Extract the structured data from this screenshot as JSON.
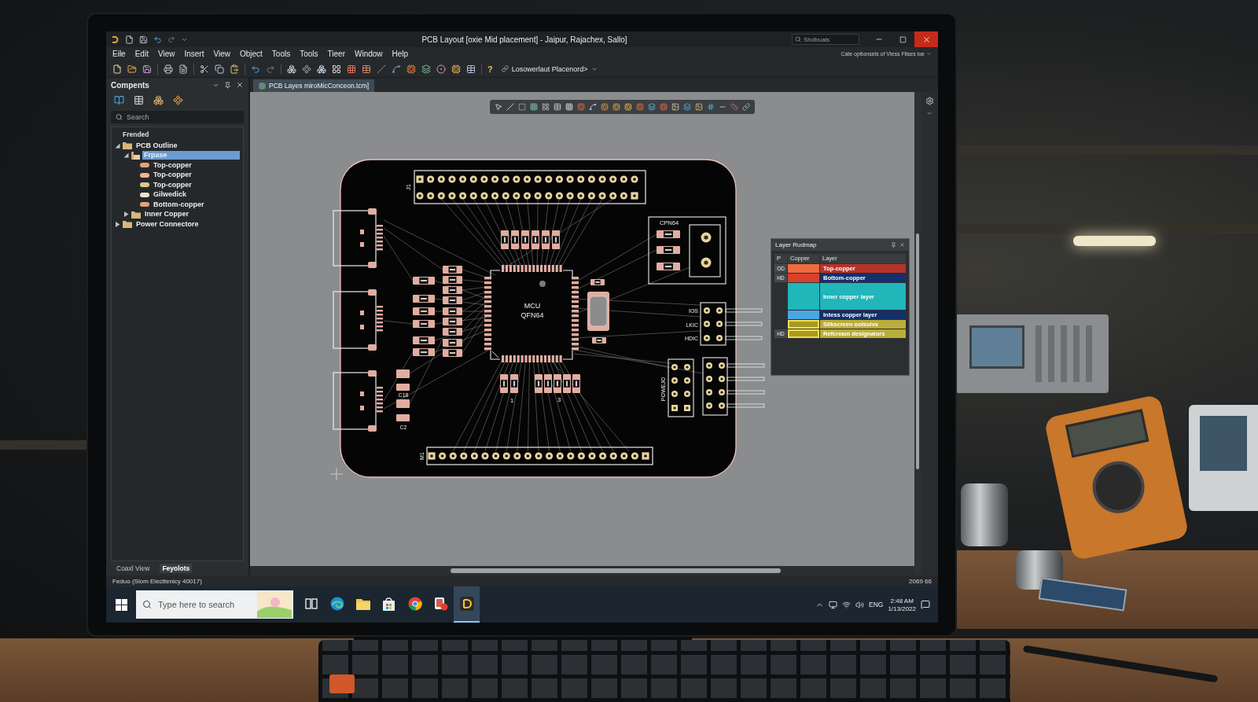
{
  "window": {
    "title": "PCB Layout [oxie Mid placement] - Jaipur, Rajachex, Sallo]",
    "search": {
      "placeholder": "Shdbuals"
    }
  },
  "menu": {
    "items": [
      "Eile",
      "Edit",
      "View",
      "Insert",
      "View",
      "Object",
      "Tools",
      "Tools",
      "Tieer",
      "Window",
      "Help"
    ],
    "hint": "Cate optionsels of Vless Flises loe"
  },
  "toolbar": {
    "help": "?",
    "placement_dropdown": "Losowerlaut Placenord>"
  },
  "components_panel": {
    "title": "Compents",
    "search": {
      "placeholder": "Search"
    },
    "tree_heading": "Frended",
    "tree": [
      {
        "label": "PCB Outline",
        "kind": "folder",
        "selected": false,
        "expanded": true,
        "children": [
          {
            "label": "Frpase",
            "kind": "part",
            "selected": true,
            "expanded": true,
            "children": [
              {
                "label": "Top-copper",
                "kind": "layer",
                "selected": false,
                "color": "#e9a07c"
              },
              {
                "label": "Top-copper",
                "kind": "layer",
                "selected": false,
                "color": "#f1b489"
              },
              {
                "label": "Top-copper",
                "kind": "layer",
                "selected": false,
                "color": "#d9c98c"
              },
              {
                "label": "Gilwedick",
                "kind": "layer",
                "selected": false,
                "color": "#efe0cc"
              },
              {
                "label": "Bottom-copper",
                "kind": "layer",
                "selected": false,
                "color": "#e3a277"
              }
            ]
          },
          {
            "label": "Inner Copper",
            "kind": "folder",
            "selected": false,
            "expanded": false
          }
        ]
      },
      {
        "label": "Power Connectore",
        "kind": "folder",
        "selected": false,
        "expanded": false
      }
    ],
    "tabs": [
      {
        "label": "Coaxl View",
        "selected": false
      },
      {
        "label": "Feyolots",
        "selected": true
      }
    ]
  },
  "document_tab": {
    "label": "PCB Layes miroMicConceon.tcm]",
    "selected": true
  },
  "pcb": {
    "top_header": "J1",
    "bottom_header": "M1",
    "mcu": [
      "MCU",
      "QFN64"
    ],
    "power_module": "CPN64",
    "capacitors": [
      "C18",
      "C2"
    ],
    "pin_labels": [
      "IOS",
      "LKIC",
      "HDIC"
    ],
    "power_header": "POWEJO",
    "marks": [
      "1",
      "3"
    ]
  },
  "layer_panel": {
    "title": "Layer Rudmap",
    "columns": [
      "P",
      "Copper",
      "Layer"
    ],
    "rows": [
      {
        "tag": "OD",
        "kind": "line",
        "selected": false,
        "swatch": {
          "color": "#f06a3c"
        },
        "layer": {
          "label": "Top-copper",
          "color": "#b7322a"
        }
      },
      {
        "tag": "HD",
        "kind": "line",
        "selected": false,
        "swatch": {
          "color": "#d9412d"
        },
        "layer": {
          "label": "Bottom-copper",
          "color": "#13306c"
        }
      },
      {
        "kind": "band",
        "selected": false,
        "swatch": {
          "color": "#20b6ba"
        },
        "layer": {
          "label": "Inner copper layer",
          "color": "#20b6ba"
        }
      },
      {
        "kind": "line",
        "selected": false,
        "swatch": {
          "color": "#4aa7e4"
        },
        "layer": {
          "label": "Intess copper layer",
          "color": "#13306c"
        }
      },
      {
        "kind": "line",
        "selected": true,
        "swatch": {
          "color": "#a99a1f"
        },
        "layer": {
          "label": "Silkscreen oolsoivs",
          "color": "#bbad3b"
        }
      },
      {
        "tag": "HD",
        "kind": "line",
        "selected": true,
        "swatch": {
          "color": "#a99a1f"
        },
        "layer": {
          "label": "Refcream designalors",
          "color": "#bbad3b"
        }
      }
    ]
  },
  "status_bar": {
    "left": "Feduo (Slom Electtenicy 40017)",
    "right": "2069 66"
  },
  "taskbar": {
    "search": {
      "placeholder": "Type here to search"
    },
    "apps": [
      {
        "kind": "task_view",
        "selected": false
      },
      {
        "kind": "edge",
        "selected": false
      },
      {
        "kind": "explorer",
        "selected": false
      },
      {
        "kind": "store",
        "selected": false
      },
      {
        "kind": "chrome",
        "selected": false
      },
      {
        "kind": "app_alert",
        "selected": false
      },
      {
        "kind": "pcb_app",
        "selected": true
      }
    ],
    "tray": {
      "language": "ENG",
      "time": "2:48 AM",
      "date": "1/13/2022"
    }
  }
}
